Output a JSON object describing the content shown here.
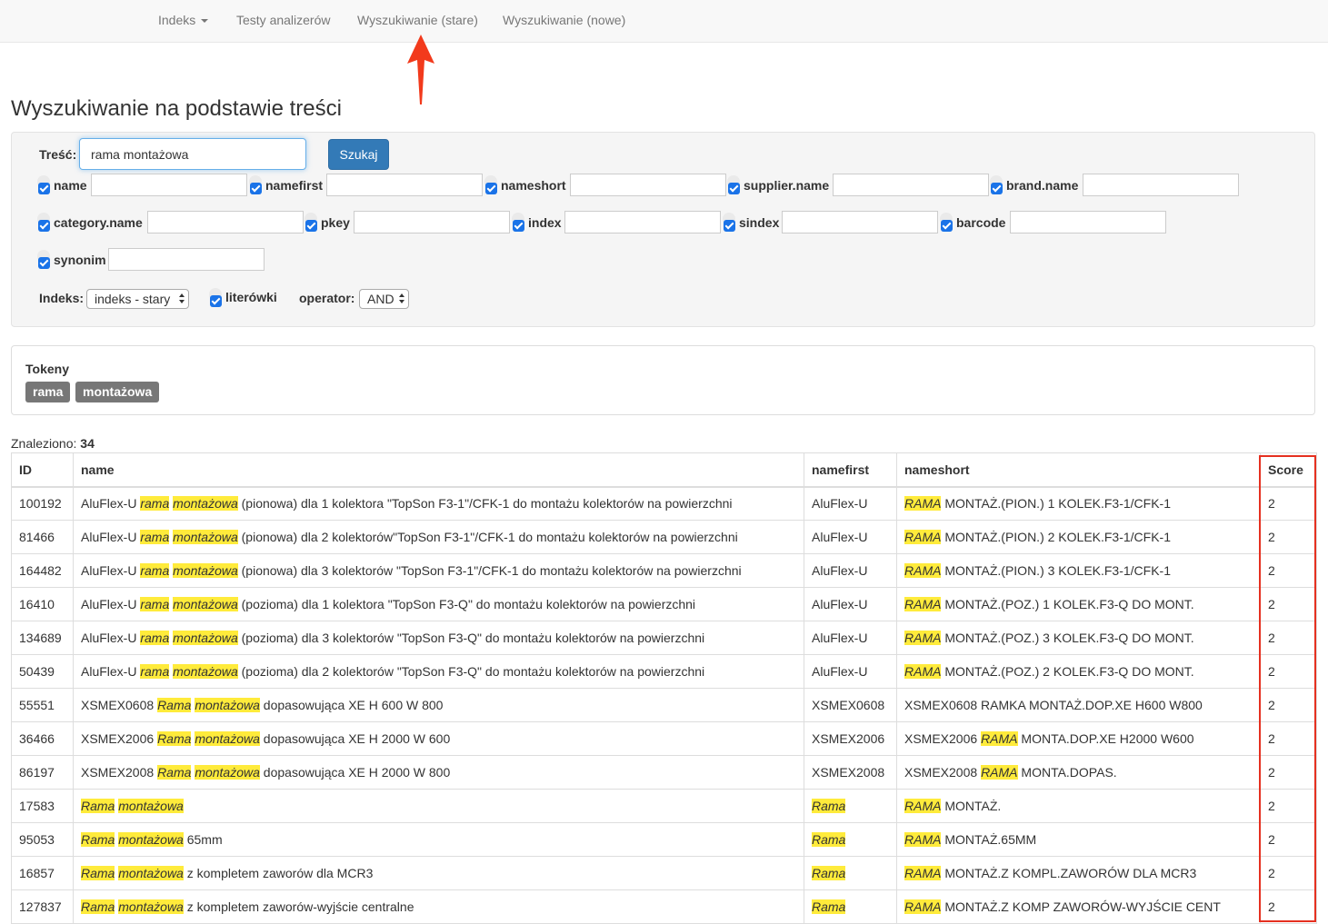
{
  "nav": {
    "items": [
      "Indeks",
      "Testy analizerów",
      "Wyszukiwanie (stare)",
      "Wyszukiwanie (nowe)"
    ]
  },
  "page_title": "Wyszukiwanie na podstawie treści",
  "search": {
    "label": "Treść:",
    "query": "rama montażowa",
    "button": "Szukaj"
  },
  "fields": [
    "name",
    "namefirst",
    "nameshort",
    "supplier.name",
    "brand.name",
    "category.name",
    "pkey",
    "index",
    "sindex",
    "barcode",
    "synonim"
  ],
  "options": {
    "index_label": "Indeks:",
    "index_value": "indeks - stary",
    "typos_label": "literówki",
    "operator_label": "operator:",
    "operator_value": "AND"
  },
  "tokens": {
    "title": "Tokeny",
    "items": [
      "rama",
      "montażowa"
    ]
  },
  "results": {
    "found_label": "Znaleziono:",
    "found_count": "34",
    "columns": [
      "ID",
      "name",
      "namefirst",
      "nameshort",
      "Score"
    ],
    "rows": [
      {
        "id": "100192",
        "name": [
          [
            "AluFlex-U ",
            0
          ],
          [
            "rama",
            1
          ],
          [
            " ",
            0
          ],
          [
            "montażowa",
            1
          ],
          [
            " (pionowa) dla 1 kolektora \"TopSon F3-1\"/CFK-1 do montażu kolektorów na powierzchni",
            0
          ]
        ],
        "namefirst": [
          [
            "AluFlex-U",
            0
          ]
        ],
        "nameshort": [
          [
            "RAMA",
            1
          ],
          [
            " MONTAŻ.(PION.) 1 KOLEK.F3-1/CFK-1",
            0
          ]
        ],
        "score": "2"
      },
      {
        "id": "81466",
        "name": [
          [
            "AluFlex-U ",
            0
          ],
          [
            "rama",
            1
          ],
          [
            " ",
            0
          ],
          [
            "montażowa",
            1
          ],
          [
            " (pionowa) dla 2 kolektorów\"TopSon F3-1\"/CFK-1 do montażu kolektorów na powierzchni",
            0
          ]
        ],
        "namefirst": [
          [
            "AluFlex-U",
            0
          ]
        ],
        "nameshort": [
          [
            "RAMA",
            1
          ],
          [
            " MONTAŻ.(PION.) 2 KOLEK.F3-1/CFK-1",
            0
          ]
        ],
        "score": "2"
      },
      {
        "id": "164482",
        "name": [
          [
            "AluFlex-U ",
            0
          ],
          [
            "rama",
            1
          ],
          [
            " ",
            0
          ],
          [
            "montażowa",
            1
          ],
          [
            " (pionowa) dla 3 kolektorów \"TopSon F3-1\"/CFK-1 do montażu kolektorów na powierzchni",
            0
          ]
        ],
        "namefirst": [
          [
            "AluFlex-U",
            0
          ]
        ],
        "nameshort": [
          [
            "RAMA",
            1
          ],
          [
            " MONTAŻ.(PION.) 3 KOLEK.F3-1/CFK-1",
            0
          ]
        ],
        "score": "2"
      },
      {
        "id": "16410",
        "name": [
          [
            "AluFlex-U ",
            0
          ],
          [
            "rama",
            1
          ],
          [
            " ",
            0
          ],
          [
            "montażowa",
            1
          ],
          [
            " (pozioma) dla 1 kolektora \"TopSon F3-Q\" do montażu kolektorów na powierzchni",
            0
          ]
        ],
        "namefirst": [
          [
            "AluFlex-U",
            0
          ]
        ],
        "nameshort": [
          [
            "RAMA",
            1
          ],
          [
            " MONTAŻ.(POZ.) 1 KOLEK.F3-Q DO MONT.",
            0
          ]
        ],
        "score": "2"
      },
      {
        "id": "134689",
        "name": [
          [
            "AluFlex-U ",
            0
          ],
          [
            "rama",
            1
          ],
          [
            " ",
            0
          ],
          [
            "montażowa",
            1
          ],
          [
            " (pozioma) dla 3 kolektorów \"TopSon F3-Q\" do montażu kolektorów na powierzchni",
            0
          ]
        ],
        "namefirst": [
          [
            "AluFlex-U",
            0
          ]
        ],
        "nameshort": [
          [
            "RAMA",
            1
          ],
          [
            " MONTAŻ.(POZ.) 3 KOLEK.F3-Q DO MONT.",
            0
          ]
        ],
        "score": "2"
      },
      {
        "id": "50439",
        "name": [
          [
            "AluFlex-U ",
            0
          ],
          [
            "rama",
            1
          ],
          [
            " ",
            0
          ],
          [
            "montażowa",
            1
          ],
          [
            " (pozioma) dla 2 kolektorów \"TopSon F3-Q\" do montażu kolektorów na powierzchni",
            0
          ]
        ],
        "namefirst": [
          [
            "AluFlex-U",
            0
          ]
        ],
        "nameshort": [
          [
            "RAMA",
            1
          ],
          [
            " MONTAŻ.(POZ.) 2 KOLEK.F3-Q DO MONT.",
            0
          ]
        ],
        "score": "2"
      },
      {
        "id": "55551",
        "name": [
          [
            "XSMEX0608 ",
            0
          ],
          [
            "Rama",
            1
          ],
          [
            " ",
            0
          ],
          [
            "montażowa",
            1
          ],
          [
            " dopasowująca XE H 600 W 800",
            0
          ]
        ],
        "namefirst": [
          [
            "XSMEX0608",
            0
          ]
        ],
        "nameshort": [
          [
            "XSMEX0608 RAMKA MONTAŻ.DOP.XE H600 W800",
            0
          ]
        ],
        "score": "2"
      },
      {
        "id": "36466",
        "name": [
          [
            "XSMEX2006 ",
            0
          ],
          [
            "Rama",
            1
          ],
          [
            " ",
            0
          ],
          [
            "montażowa",
            1
          ],
          [
            " dopasowująca XE H 2000 W 600",
            0
          ]
        ],
        "namefirst": [
          [
            "XSMEX2006",
            0
          ]
        ],
        "nameshort": [
          [
            "XSMEX2006 ",
            0
          ],
          [
            "RAMA",
            1
          ],
          [
            " MONTA.DOP.XE H2000 W600",
            0
          ]
        ],
        "score": "2"
      },
      {
        "id": "86197",
        "name": [
          [
            "XSMEX2008 ",
            0
          ],
          [
            "Rama",
            1
          ],
          [
            " ",
            0
          ],
          [
            "montażowa",
            1
          ],
          [
            " dopasowująca XE H 2000 W 800",
            0
          ]
        ],
        "namefirst": [
          [
            "XSMEX2008",
            0
          ]
        ],
        "nameshort": [
          [
            "XSMEX2008 ",
            0
          ],
          [
            "RAMA",
            1
          ],
          [
            " MONTA.DOPAS.",
            0
          ]
        ],
        "score": "2"
      },
      {
        "id": "17583",
        "name": [
          [
            "Rama",
            1
          ],
          [
            " ",
            0
          ],
          [
            "montażowa",
            1
          ]
        ],
        "namefirst": [
          [
            "Rama",
            1
          ]
        ],
        "nameshort": [
          [
            "RAMA",
            1
          ],
          [
            " MONTAŻ.",
            0
          ]
        ],
        "score": "2"
      },
      {
        "id": "95053",
        "name": [
          [
            "Rama",
            1
          ],
          [
            " ",
            0
          ],
          [
            "montażowa",
            1
          ],
          [
            " 65mm",
            0
          ]
        ],
        "namefirst": [
          [
            "Rama",
            1
          ]
        ],
        "nameshort": [
          [
            "RAMA",
            1
          ],
          [
            " MONTAŻ.65MM",
            0
          ]
        ],
        "score": "2"
      },
      {
        "id": "16857",
        "name": [
          [
            "Rama",
            1
          ],
          [
            " ",
            0
          ],
          [
            "montażowa",
            1
          ],
          [
            " z kompletem zaworów dla MCR3",
            0
          ]
        ],
        "namefirst": [
          [
            "Rama",
            1
          ]
        ],
        "nameshort": [
          [
            "RAMA",
            1
          ],
          [
            " MONTAŻ.Z KOMPL.ZAWORÓW DLA MCR3",
            0
          ]
        ],
        "score": "2"
      },
      {
        "id": "127837",
        "name": [
          [
            "Rama",
            1
          ],
          [
            " ",
            0
          ],
          [
            "montażowa",
            1
          ],
          [
            " z kompletem zaworów-wyjście centralne",
            0
          ]
        ],
        "namefirst": [
          [
            "Rama",
            1
          ]
        ],
        "nameshort": [
          [
            "RAMA",
            1
          ],
          [
            " MONTAŻ.Z KOMP ZAWORÓW-WYJŚCIE CENT",
            0
          ]
        ],
        "score": "2"
      }
    ]
  },
  "colors": {
    "highlight": "#ffeb3b",
    "primary": "#337ab7",
    "annotation": "#e53020"
  }
}
